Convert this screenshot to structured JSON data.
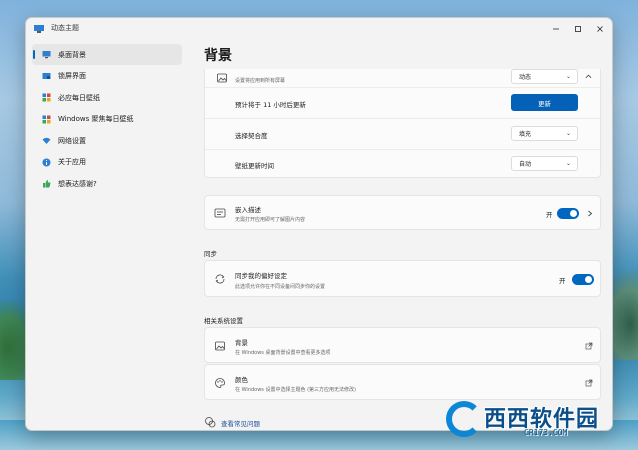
{
  "window": {
    "title": "动态主题"
  },
  "sidebar": {
    "items": [
      {
        "label": "桌面背景",
        "active": true
      },
      {
        "label": "锁屏界面"
      },
      {
        "label": "必应每日壁纸"
      },
      {
        "label": "Windows 聚焦每日壁纸"
      },
      {
        "label": "网络设置"
      },
      {
        "label": "关于应用"
      },
      {
        "label": "想表达感谢?"
      }
    ]
  },
  "main": {
    "page_title": "背景",
    "card1": {
      "row0": {
        "desc": "设置将应用到所有屏幕",
        "value": "动态"
      },
      "row1": {
        "title": "预计将于 11 小时后更新",
        "button": "更新"
      },
      "row2": {
        "title": "选择契合度",
        "value": "填充"
      },
      "row3": {
        "title": "壁纸更新时间",
        "value": "自动"
      }
    },
    "embed": {
      "title": "嵌入描述",
      "desc": "无需打开应用即可了解图片内容",
      "toggle_label": "开"
    },
    "sync_section": "同步",
    "sync": {
      "title": "同步我的偏好设定",
      "desc": "此选项允许你在不同设备间同步你的设置",
      "toggle_label": "开"
    },
    "related_section": "相关系统设置",
    "related": [
      {
        "title": "背景",
        "desc": "在 Windows 桌面背景设置中查看更多选项"
      },
      {
        "title": "颜色",
        "desc": "在 Windows 设置中选择主题色 (第三方应用无法修改)"
      }
    ],
    "help_link": "查看常见问题"
  },
  "watermark": {
    "text": "西西软件园",
    "sub": "CR173.COM"
  },
  "colors": {
    "accent": "#0067c0",
    "button": "#0560b8"
  }
}
